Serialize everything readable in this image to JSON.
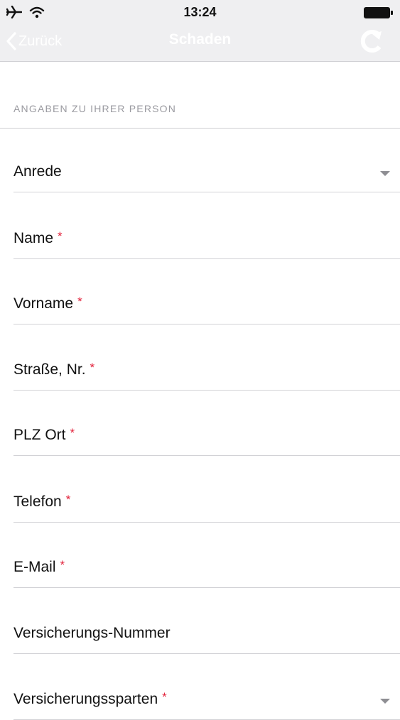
{
  "status_bar": {
    "time": "13:24"
  },
  "nav": {
    "back_label": "Zurück",
    "title": "Schaden"
  },
  "section": {
    "header": "ANGABEN ZU IHRER PERSON"
  },
  "fields": [
    {
      "label": "Anrede",
      "required": false,
      "type": "dropdown"
    },
    {
      "label": "Name",
      "required": true,
      "type": "text"
    },
    {
      "label": "Vorname",
      "required": true,
      "type": "text"
    },
    {
      "label": "Straße, Nr.",
      "required": true,
      "type": "text"
    },
    {
      "label": "PLZ Ort",
      "required": true,
      "type": "text"
    },
    {
      "label": "Telefon",
      "required": true,
      "type": "text"
    },
    {
      "label": "E-Mail",
      "required": true,
      "type": "text"
    },
    {
      "label": "Versicherungs-Nummer",
      "required": false,
      "type": "text"
    },
    {
      "label": "Versicherungssparten",
      "required": true,
      "type": "dropdown"
    }
  ],
  "required_marker": "*",
  "colors": {
    "required": "#e2223b",
    "nav_bg": "#efeff1",
    "section_header": "#9a9aa0"
  }
}
